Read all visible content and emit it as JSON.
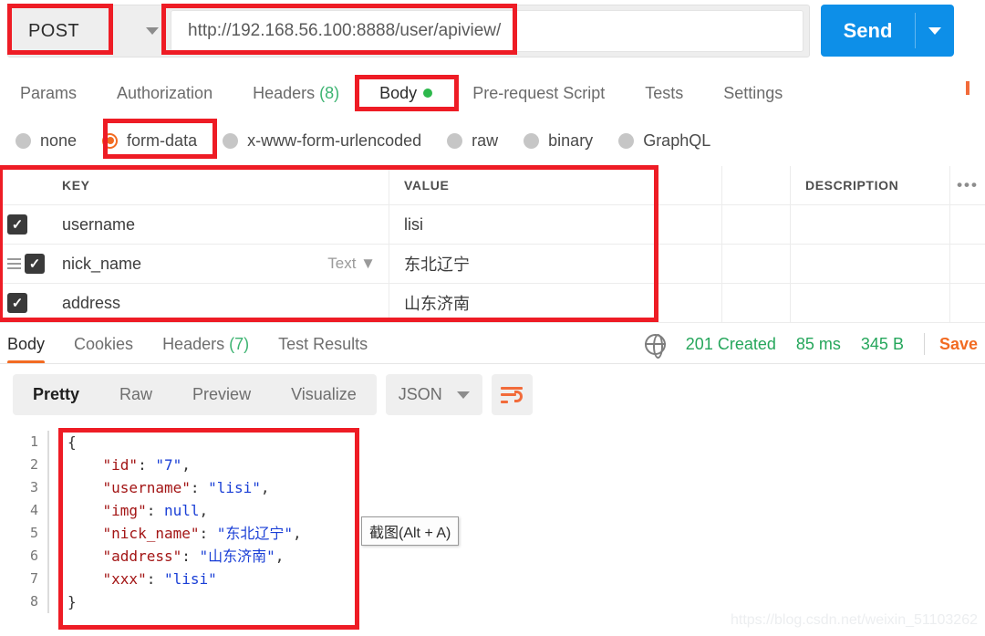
{
  "request": {
    "method": "POST",
    "url": "http://192.168.56.100:8888/user/apiview/",
    "send_label": "Send",
    "tabs": [
      {
        "label": "Params",
        "count": "",
        "active": false
      },
      {
        "label": "Authorization",
        "count": "",
        "active": false
      },
      {
        "label": "Headers",
        "count": "(8)",
        "active": false
      },
      {
        "label": "Body",
        "count": "",
        "active": true,
        "dot": true
      },
      {
        "label": "Pre-request Script",
        "count": "",
        "active": false
      },
      {
        "label": "Tests",
        "count": "",
        "active": false
      },
      {
        "label": "Settings",
        "count": "",
        "active": false
      }
    ],
    "body_types": [
      {
        "label": "none",
        "selected": false
      },
      {
        "label": "form-data",
        "selected": true
      },
      {
        "label": "x-www-form-urlencoded",
        "selected": false
      },
      {
        "label": "raw",
        "selected": false
      },
      {
        "label": "binary",
        "selected": false
      },
      {
        "label": "GraphQL",
        "selected": false
      }
    ],
    "table": {
      "headers": {
        "key": "KEY",
        "value": "VALUE",
        "description": "DESCRIPTION",
        "more": "•••"
      },
      "rows": [
        {
          "checked": true,
          "key": "username",
          "type": "",
          "value": "lisi",
          "description": ""
        },
        {
          "checked": true,
          "key": "nick_name",
          "type": "Text ▼",
          "value": "东北辽宁",
          "description": ""
        },
        {
          "checked": true,
          "key": "address",
          "type": "",
          "value": "山东济南",
          "description": ""
        }
      ]
    }
  },
  "response": {
    "tabs": [
      {
        "label": "Body",
        "count": "",
        "active": true
      },
      {
        "label": "Cookies",
        "count": "",
        "active": false
      },
      {
        "label": "Headers",
        "count": "(7)",
        "active": false
      },
      {
        "label": "Test Results",
        "count": "",
        "active": false
      }
    ],
    "status": "201 Created",
    "time": "85 ms",
    "size": "345 B",
    "save_label": "Save",
    "view_tabs": [
      {
        "label": "Pretty",
        "active": true
      },
      {
        "label": "Raw",
        "active": false
      },
      {
        "label": "Preview",
        "active": false
      },
      {
        "label": "Visualize",
        "active": false
      }
    ],
    "format": "JSON",
    "body_lines": [
      {
        "num": "1",
        "indent": 0,
        "tokens": [
          {
            "t": "p",
            "v": "{"
          }
        ]
      },
      {
        "num": "2",
        "indent": 1,
        "tokens": [
          {
            "t": "k",
            "v": "\"id\""
          },
          {
            "t": "p",
            "v": ": "
          },
          {
            "t": "s",
            "v": "\"7\""
          },
          {
            "t": "p",
            "v": ","
          }
        ]
      },
      {
        "num": "3",
        "indent": 1,
        "tokens": [
          {
            "t": "k",
            "v": "\"username\""
          },
          {
            "t": "p",
            "v": ": "
          },
          {
            "t": "s",
            "v": "\"lisi\""
          },
          {
            "t": "p",
            "v": ","
          }
        ]
      },
      {
        "num": "4",
        "indent": 1,
        "tokens": [
          {
            "t": "k",
            "v": "\"img\""
          },
          {
            "t": "p",
            "v": ": "
          },
          {
            "t": "n",
            "v": "null"
          },
          {
            "t": "p",
            "v": ","
          }
        ]
      },
      {
        "num": "5",
        "indent": 1,
        "tokens": [
          {
            "t": "k",
            "v": "\"nick_name\""
          },
          {
            "t": "p",
            "v": ": "
          },
          {
            "t": "s",
            "v": "\"东北辽宁\""
          },
          {
            "t": "p",
            "v": ","
          }
        ]
      },
      {
        "num": "6",
        "indent": 1,
        "tokens": [
          {
            "t": "k",
            "v": "\"address\""
          },
          {
            "t": "p",
            "v": ": "
          },
          {
            "t": "s",
            "v": "\"山东济南\""
          },
          {
            "t": "p",
            "v": ","
          }
        ]
      },
      {
        "num": "7",
        "indent": 1,
        "tokens": [
          {
            "t": "k",
            "v": "\"xxx\""
          },
          {
            "t": "p",
            "v": ": "
          },
          {
            "t": "s",
            "v": "\"lisi\""
          }
        ]
      },
      {
        "num": "8",
        "indent": 0,
        "tokens": [
          {
            "t": "p",
            "v": "}"
          }
        ]
      }
    ]
  },
  "overlay": {
    "tooltip": "截图(Alt + A)",
    "watermark": "https://blog.csdn.net/weixin_51103262",
    "annotation_color": "#ee1c25"
  }
}
